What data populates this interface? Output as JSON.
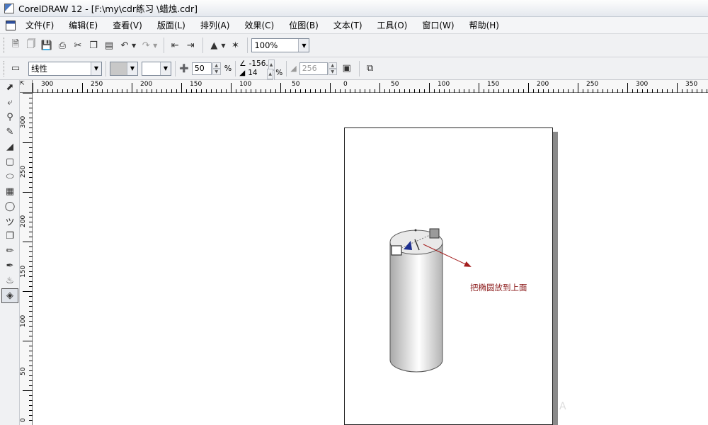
{
  "window": {
    "title": "CorelDRAW 12 - [F:\\my\\cdr练习  \\蜡烛.cdr]"
  },
  "menu": [
    "文件(F)",
    "编辑(E)",
    "查看(V)",
    "版面(L)",
    "排列(A)",
    "效果(C)",
    "位图(B)",
    "文本(T)",
    "工具(O)",
    "窗口(W)",
    "帮助(H)"
  ],
  "toolbar": {
    "zoom": "100%",
    "icons": [
      "new-icon",
      "open-icon",
      "save-icon",
      "print-icon",
      "cut-icon",
      "copy-icon",
      "paste-icon",
      "undo-icon",
      "redo-icon",
      "import-icon",
      "export-icon",
      "app-launcher-icon",
      "welcome-icon"
    ]
  },
  "property_bar": {
    "fill_type": "线性",
    "midpoint": "50",
    "percent_unit": "%",
    "angle": "-156.0",
    "edge_pad": "14",
    "steps": "256"
  },
  "tools": [
    "pick-tool-icon",
    "shape-tool-icon",
    "zoom-tool-icon",
    "freehand-tool-icon",
    "smart-fill-icon",
    "rectangle-tool-icon",
    "ellipse-tool-icon",
    "graph-paper-icon",
    "basic-shapes-icon",
    "text-tool-icon",
    "interactive-drop-shadow-icon",
    "eyedropper-icon",
    "outline-tool-icon",
    "fill-tool-icon",
    "interactive-fill-icon"
  ],
  "rulers": {
    "horizontal": [
      "300",
      "250",
      "200",
      "150",
      "100",
      "50",
      "0",
      "50",
      "100",
      "150",
      "200",
      "250",
      "300",
      "350"
    ],
    "vertical": [
      "300",
      "250",
      "200",
      "150",
      "100",
      "50",
      "0"
    ]
  },
  "canvas": {
    "annotation": "把椭圆放到上面",
    "watermark": "A"
  },
  "colors": {
    "annotation": "#8b1a1a",
    "fill_handle_arrow": "#1c2e8f",
    "cylinder_light": "#ffffff",
    "cylinder_dark": "#aaaaaa"
  }
}
